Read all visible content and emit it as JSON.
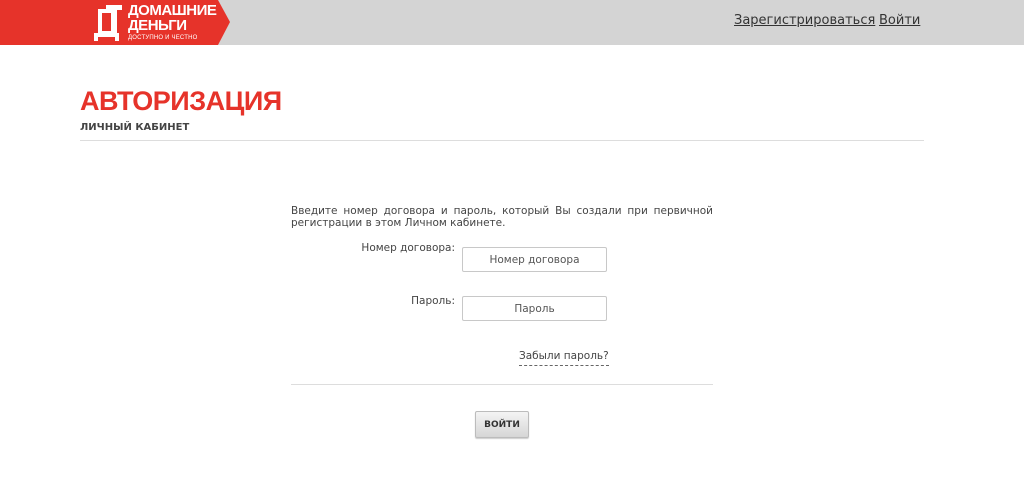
{
  "header": {
    "logo": {
      "line1": "ДОМАШНИЕ",
      "line2": "ДЕНЬГИ",
      "tagline": "ДОСТУПНО И ЧЕСТНО"
    },
    "nav": {
      "register": "Зарегистрироваться",
      "login": "Войти"
    }
  },
  "page": {
    "title": "АВТОРИЗАЦИЯ",
    "subtitle": "ЛИЧНЫЙ КАБИНЕТ"
  },
  "form": {
    "intro": "Введите номер договора и пароль, который Вы создали при первичной регистрации в этом Личном кабинете.",
    "contract_label": "Номер договора:",
    "contract_placeholder": "Номер договора",
    "password_label": "Пароль:",
    "password_placeholder": "Пароль",
    "forgot": "Забыли пароль?",
    "submit": "ВОЙТИ"
  },
  "colors": {
    "brand": "#e6332a",
    "topbar": "#d4d4d4"
  }
}
